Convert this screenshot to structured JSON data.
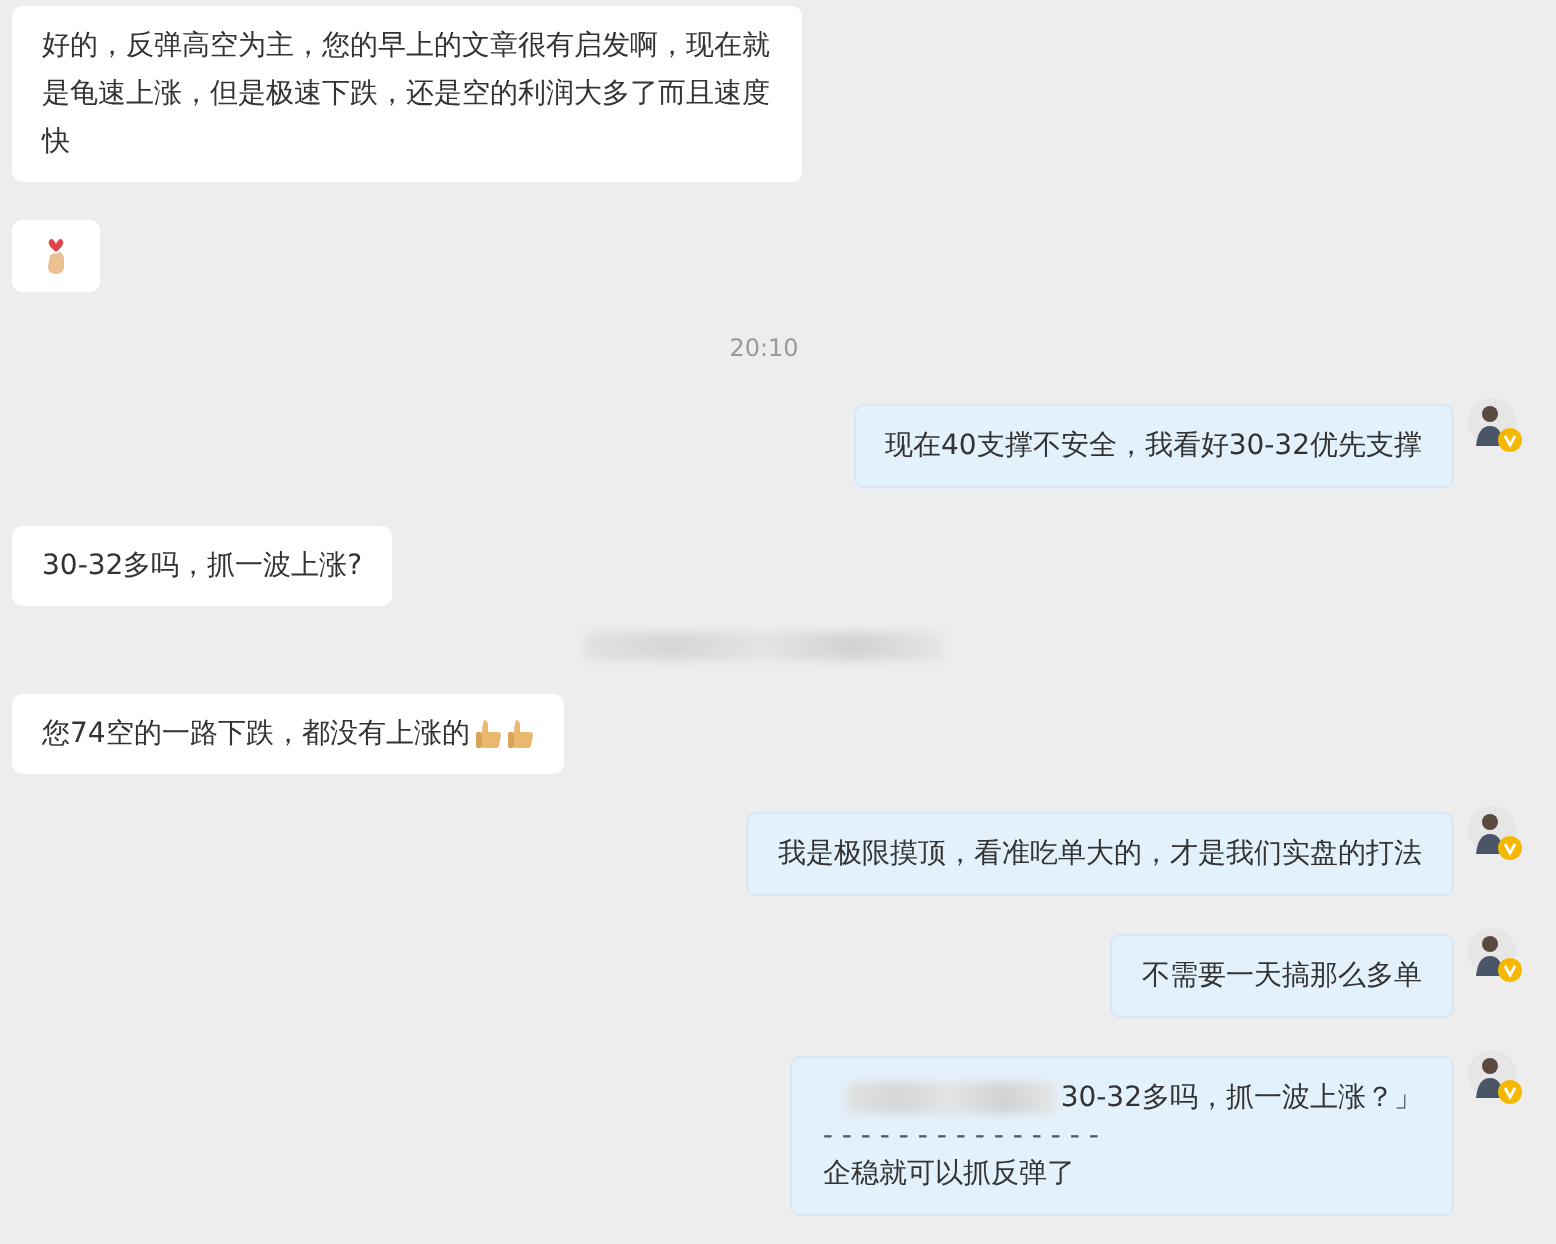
{
  "messages": [
    {
      "kind": "bubble",
      "outgoing": false,
      "parts": [
        {
          "kind": "text",
          "text": "好的，反弹高空为主，您的早上的文章很有启发啊，现在就是龟速上涨，但是极速下跌，还是空的利润大多了而且速度快"
        }
      ]
    },
    {
      "kind": "bubble",
      "outgoing": false,
      "parts": [
        {
          "kind": "heart"
        }
      ]
    },
    {
      "kind": "time",
      "text": "20:10"
    },
    {
      "kind": "bubble",
      "outgoing": true,
      "parts": [
        {
          "kind": "text",
          "text": "现在40支撑不安全，我看好30-32优先支撑"
        }
      ]
    },
    {
      "kind": "bubble",
      "outgoing": false,
      "parts": [
        {
          "kind": "text",
          "text": "30-32多吗，抓一波上涨?"
        }
      ]
    },
    {
      "kind": "redacted"
    },
    {
      "kind": "bubble",
      "outgoing": false,
      "parts": [
        {
          "kind": "text",
          "text": "您74空的一路下跌，都没有上涨的"
        },
        {
          "kind": "thumb"
        },
        {
          "kind": "thumb"
        }
      ]
    },
    {
      "kind": "bubble",
      "outgoing": true,
      "parts": [
        {
          "kind": "text",
          "text": "我是极限摸顶，看准吃单大的，才是我们实盘的打法"
        }
      ]
    },
    {
      "kind": "bubble",
      "outgoing": true,
      "parts": [
        {
          "kind": "text",
          "text": "不需要一天搞那么多单"
        }
      ]
    },
    {
      "kind": "quote",
      "outgoing": true,
      "quoted": "30-32多吗，抓一波上涨？」",
      "divider": "- - - - - - - - - - - - - - -",
      "text": "企稳就可以抓反弹了"
    }
  ]
}
